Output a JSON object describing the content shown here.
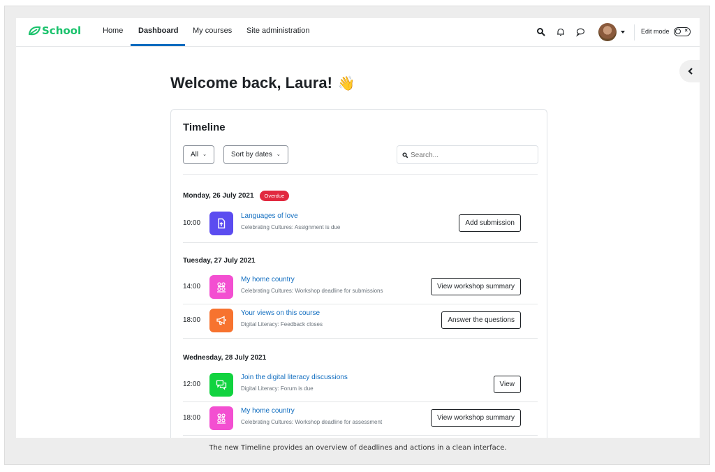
{
  "app": {
    "brand": "School"
  },
  "nav": {
    "items": [
      "Home",
      "Dashboard",
      "My courses",
      "Site administration"
    ],
    "active": "Dashboard",
    "edit_mode_label": "Edit mode"
  },
  "main": {
    "welcome": "Welcome back, Laura!",
    "welcome_emoji": "👋"
  },
  "timeline": {
    "title": "Timeline",
    "filter_label": "All",
    "sort_label": "Sort by dates",
    "search_placeholder": "Search...",
    "groups": [
      {
        "date": "Monday, 26 July 2021",
        "badge": "Overdue",
        "events": [
          {
            "time": "10:00",
            "name": "Languages of love",
            "sub": "Celebrating Cultures: Assignment is due",
            "action": "Add submission",
            "icon": "assignment-icon",
            "color": "#5b4cf0"
          }
        ]
      },
      {
        "date": "Tuesday, 27 July 2021",
        "events": [
          {
            "time": "14:00",
            "name": "My home country",
            "sub": "Celebrating Cultures: Workshop deadline for submissions",
            "action": "View workshop summary",
            "icon": "workshop-icon",
            "color": "#f34fd1"
          },
          {
            "time": "18:00",
            "name": "Your views on this course",
            "sub": "Digital Literacy: Feedback closes",
            "action": "Answer the questions",
            "icon": "megaphone-icon",
            "color": "#f7732f"
          }
        ]
      },
      {
        "date": "Wednesday, 28 July 2021",
        "events": [
          {
            "time": "12:00",
            "name": "Join the digital literacy discussions",
            "sub": "Digital Literacy: Forum is due",
            "action": "View",
            "icon": "forum-icon",
            "color": "#11d33f"
          },
          {
            "time": "18:00",
            "name": "My home country",
            "sub": "Celebrating Cultures: Workshop deadline for assessment",
            "action": "View workshop summary",
            "icon": "workshop-icon",
            "color": "#f34fd1"
          }
        ]
      }
    ]
  },
  "caption": "The new Timeline provides an overview of deadlines and actions in a clean interface."
}
